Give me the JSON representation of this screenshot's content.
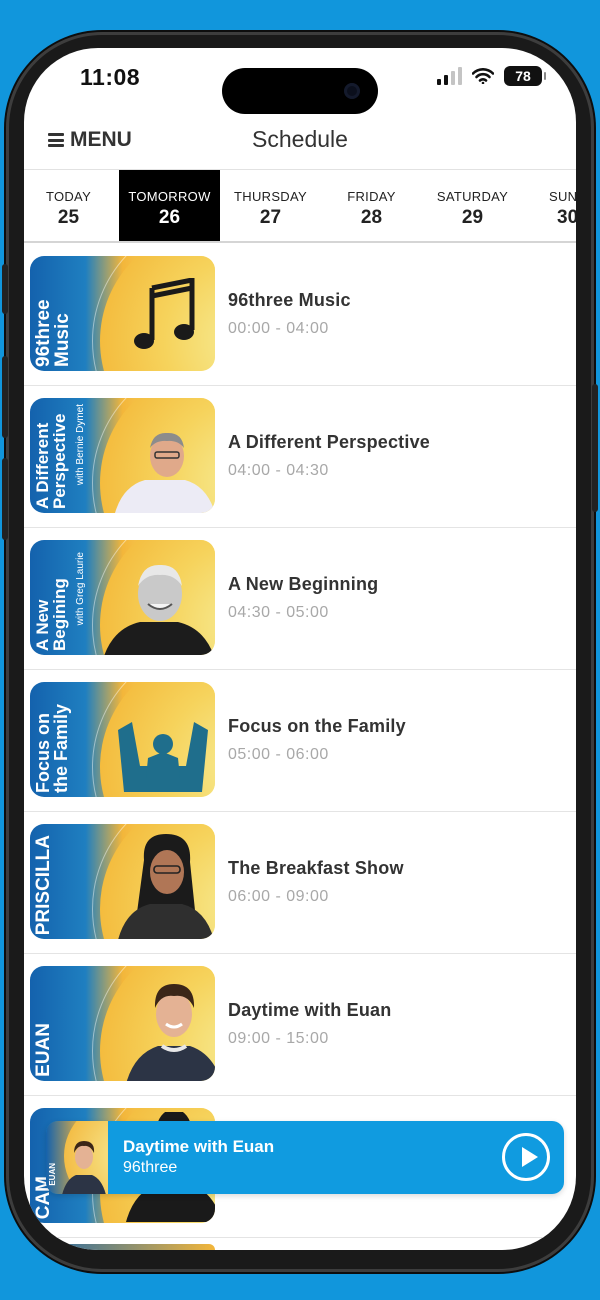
{
  "status_bar": {
    "time": "11:08",
    "battery": "78"
  },
  "header": {
    "menu_label": "MENU",
    "title": "Schedule"
  },
  "tabs": [
    {
      "day": "TODAY",
      "num": "25",
      "active": false
    },
    {
      "day": "TOMORROW",
      "num": "26",
      "active": true
    },
    {
      "day": "THURSDAY",
      "num": "27",
      "active": false
    },
    {
      "day": "FRIDAY",
      "num": "28",
      "active": false
    },
    {
      "day": "SATURDAY",
      "num": "29",
      "active": false
    },
    {
      "day": "SUNDAY",
      "num": "30",
      "active": false
    }
  ],
  "schedule": [
    {
      "thumb_text": "96three Music",
      "thumb_sub": "",
      "title": "96three Music",
      "time": "00:00 - 04:00"
    },
    {
      "thumb_text": "A Different Perspective",
      "thumb_sub": "with Bernie Dymet",
      "title": "A Different Perspective",
      "time": "04:00 - 04:30"
    },
    {
      "thumb_text": "A New Begining",
      "thumb_sub": "with Greg Laurie",
      "title": "A New Beginning",
      "time": "04:30 - 05:00"
    },
    {
      "thumb_text": "Focus on the Family",
      "thumb_sub": "",
      "title": "Focus on the Family",
      "time": "05:00 - 06:00"
    },
    {
      "thumb_text": "PRISCILLA",
      "thumb_sub": "",
      "title": "The Breakfast Show",
      "time": "06:00 - 09:00"
    },
    {
      "thumb_text": "EUAN",
      "thumb_sub": "",
      "title": "Daytime with Euan",
      "time": "09:00 - 15:00"
    },
    {
      "thumb_text": "CAM",
      "thumb_sub": "",
      "title": "",
      "time": ""
    }
  ],
  "player": {
    "title": "Daytime with Euan",
    "subtitle": "96three",
    "thumb_text": "EUAN"
  },
  "colors": {
    "background": "#1196dc",
    "player": "#109be0",
    "active_tab": "#000000"
  }
}
